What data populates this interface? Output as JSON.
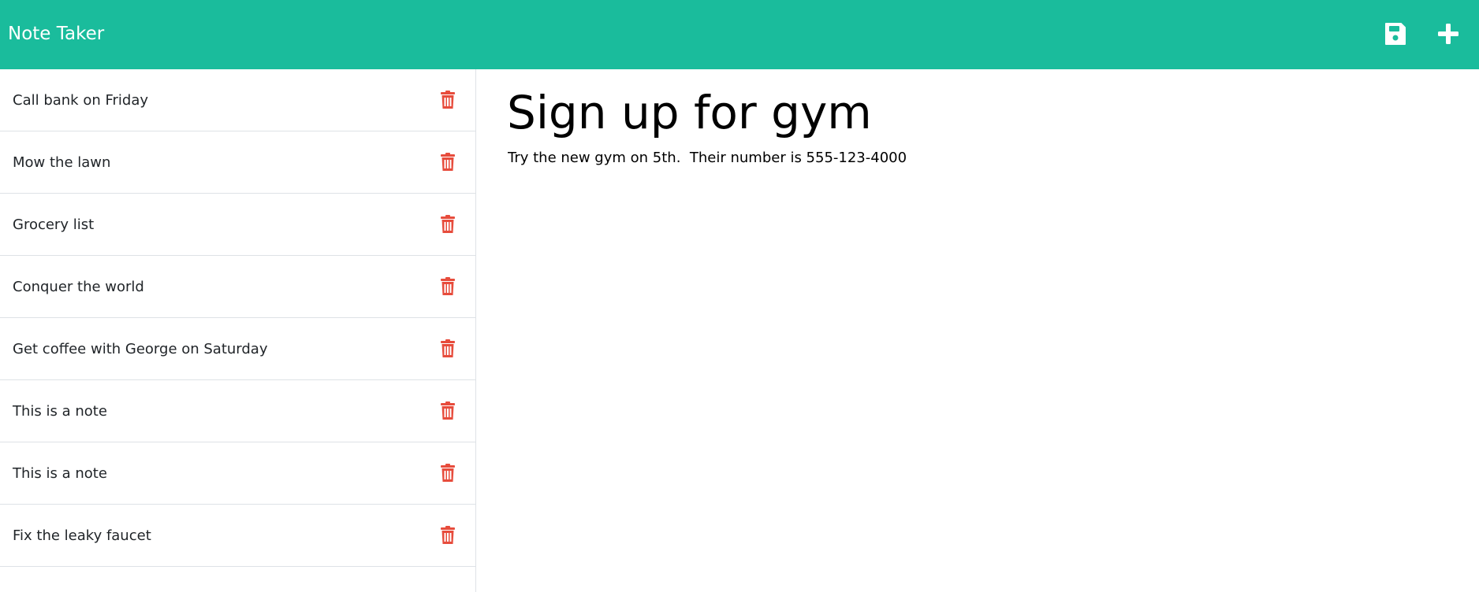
{
  "app": {
    "brand": "Note Taker",
    "colors": {
      "navbar": "#1abc9c",
      "delete": "#e74c3c",
      "divider": "#dee2e6"
    },
    "icons": {
      "save": "save-icon",
      "new": "plus-icon",
      "delete": "trash-icon"
    }
  },
  "notes": [
    {
      "title": "Call bank on Friday"
    },
    {
      "title": "Mow the lawn"
    },
    {
      "title": "Grocery list"
    },
    {
      "title": "Conquer the world"
    },
    {
      "title": "Get coffee with George on Saturday"
    },
    {
      "title": "This is a note"
    },
    {
      "title": "This is a note"
    },
    {
      "title": "Fix the leaky faucet"
    }
  ],
  "active_note": {
    "title": "Sign up for gym",
    "text": "Try the new gym on 5th.  Their number is 555-123-4000"
  }
}
